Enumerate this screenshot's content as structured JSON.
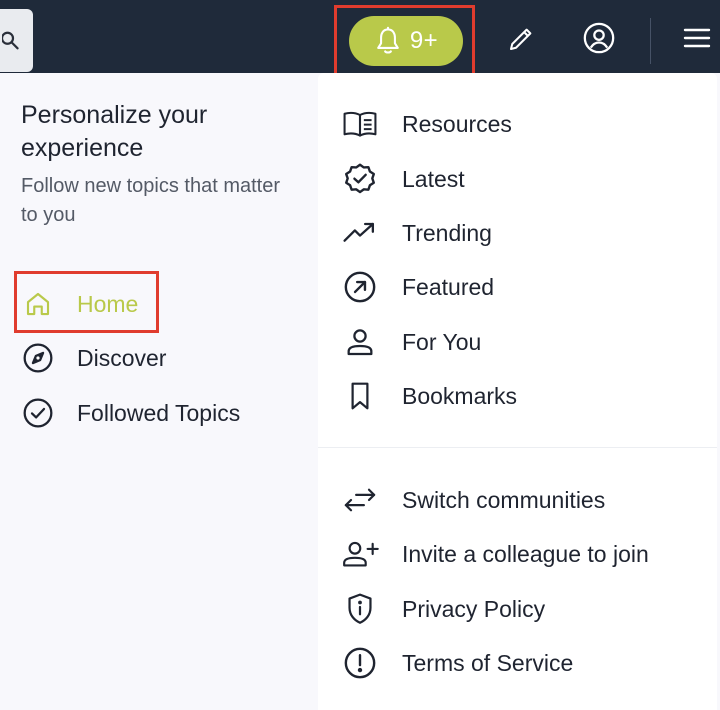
{
  "header": {
    "notification_count": "9+",
    "colors": {
      "bar": "#1f2a3a",
      "accent": "#b9c94a",
      "highlight": "#e03c2e"
    },
    "icons": [
      "search-icon",
      "bell-icon",
      "pencil-icon",
      "user-circle-icon",
      "hamburger-menu-icon"
    ]
  },
  "left": {
    "headline": "Personalize your experience",
    "subtext": "Follow new topics that matter to you",
    "nav": [
      {
        "label": "Home",
        "icon": "home-icon",
        "active": true
      },
      {
        "label": "Discover",
        "icon": "compass-icon"
      },
      {
        "label": "Followed Topics",
        "icon": "check-circle-icon"
      }
    ]
  },
  "menu": {
    "primary": [
      {
        "label": "Resources",
        "icon": "book-icon"
      },
      {
        "label": "Latest",
        "icon": "badge-check-icon"
      },
      {
        "label": "Trending",
        "icon": "trending-up-icon"
      },
      {
        "label": "Featured",
        "icon": "arrow-up-right-circle-icon"
      },
      {
        "label": "For You",
        "icon": "person-icon"
      },
      {
        "label": "Bookmarks",
        "icon": "bookmark-icon"
      }
    ],
    "secondary": [
      {
        "label": "Switch communities",
        "icon": "arrows-left-right-icon"
      },
      {
        "label": "Invite a colleague to join",
        "icon": "user-plus-icon"
      },
      {
        "label": "Privacy Policy",
        "icon": "shield-info-icon"
      },
      {
        "label": "Terms of Service",
        "icon": "alert-circle-icon"
      }
    ]
  }
}
